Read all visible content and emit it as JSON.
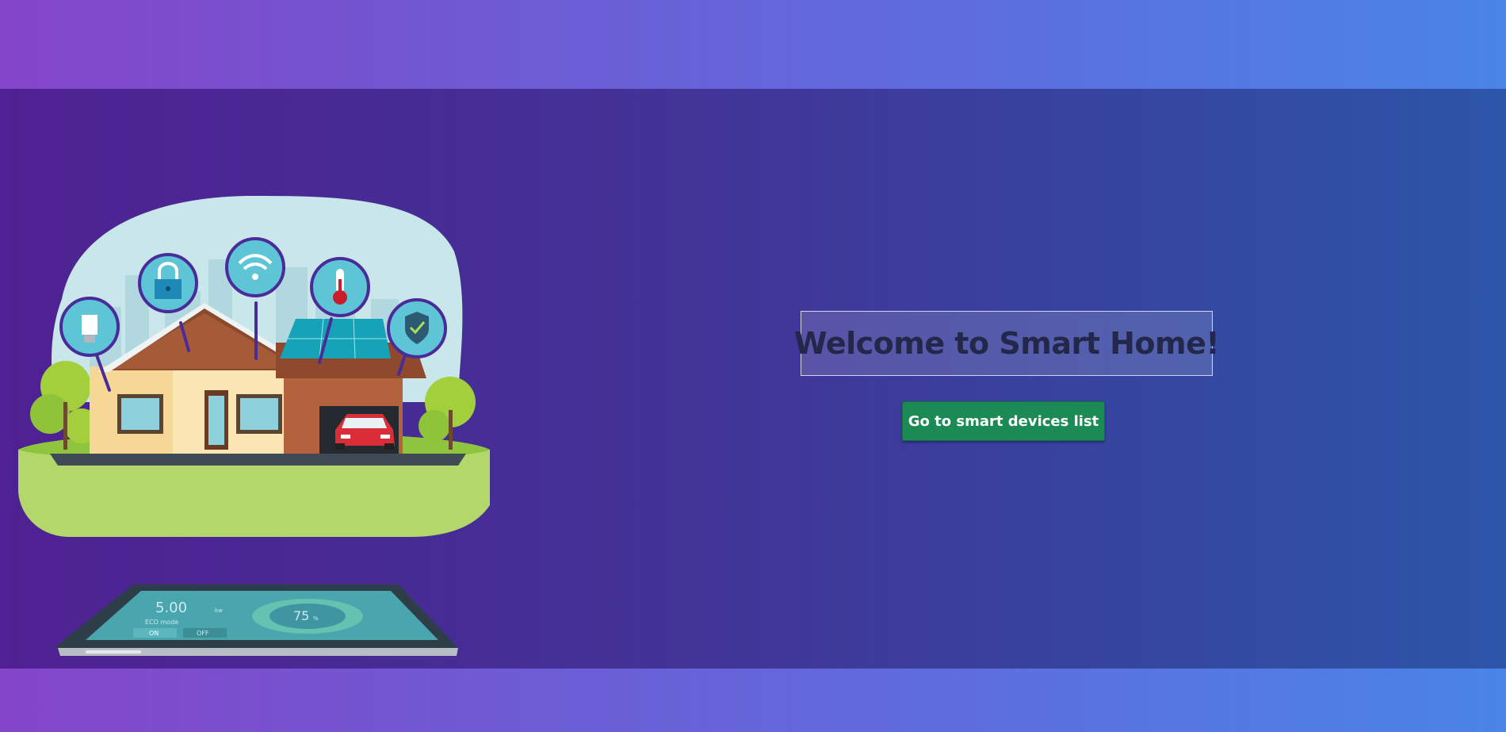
{
  "hero": {
    "welcome_title": "Welcome to Smart Home!",
    "cta_label": "Go to smart devices list",
    "cta_color": "#1c8a55"
  },
  "illustration": {
    "icons": [
      "bulb-icon",
      "lock-icon",
      "wifi-icon",
      "thermometer-icon",
      "shield-check-icon"
    ],
    "tablet": {
      "reading": "5.00",
      "reading_unit": "kw",
      "mode_label": "ECO mode",
      "on_label": "ON",
      "off_label": "OFF",
      "gauge_value": "75",
      "gauge_unit": "%"
    }
  },
  "colors": {
    "background_start": "#8445c9",
    "background_end": "#4a84e6",
    "hero_start": "#4f2192",
    "hero_end": "#2c55a8"
  }
}
